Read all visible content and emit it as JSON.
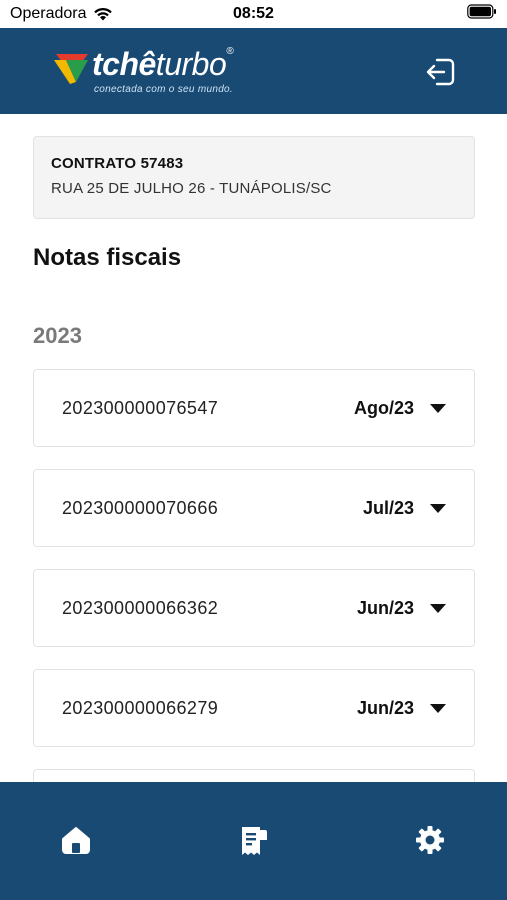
{
  "status_bar": {
    "carrier": "Operadora",
    "time": "08:52"
  },
  "header": {
    "logo_text_bold": "tchê",
    "logo_text_light": "turbo",
    "logo_tagline": "conectada com o seu mundo.",
    "logout_icon": "logout-icon"
  },
  "contract": {
    "title": "CONTRATO 57483",
    "address": "RUA 25 DE JULHO 26 - TUNÁPOLIS/SC"
  },
  "section_title": "Notas fiscais",
  "year": "2023",
  "invoices": [
    {
      "number": "202300000076547",
      "month": "Ago/23"
    },
    {
      "number": "202300000070666",
      "month": "Jul/23"
    },
    {
      "number": "202300000066362",
      "month": "Jun/23"
    },
    {
      "number": "202300000066279",
      "month": "Jun/23"
    }
  ],
  "bottom_nav": {
    "items": [
      "home-icon",
      "invoice-icon",
      "settings-icon"
    ]
  },
  "colors": {
    "brand_blue": "#194a73",
    "card_bg": "#f4f4f4",
    "year_gray": "#7a7a7a"
  }
}
